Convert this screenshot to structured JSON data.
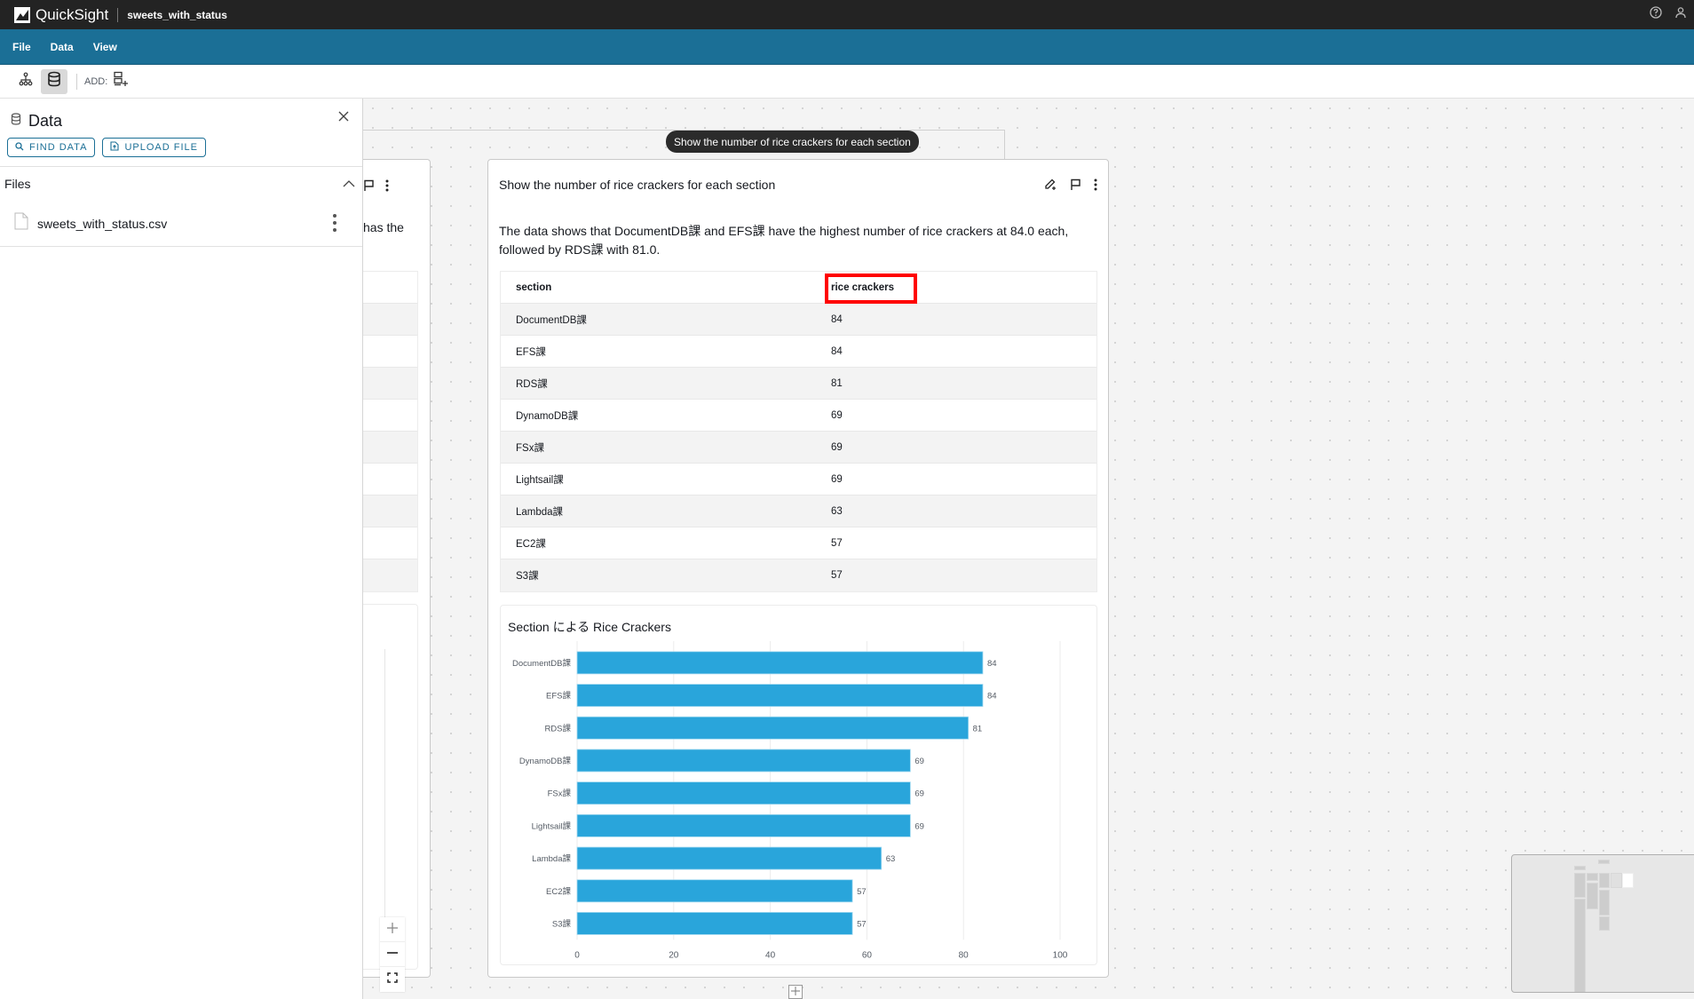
{
  "titlebar": {
    "app_name": "QuickSight",
    "file_title": "sweets_with_status",
    "icons": [
      "help-icon",
      "user-icon"
    ]
  },
  "menu": {
    "items": [
      "File",
      "Data",
      "View"
    ]
  },
  "toolbar": {
    "add_label": "ADD:",
    "icons": [
      "hierarchy-icon",
      "database-icon",
      "add-visual-icon"
    ]
  },
  "data_panel": {
    "title": "Data",
    "find_data_label": "FIND DATA",
    "upload_file_label": "UPLOAD FILE",
    "files_header": "Files",
    "files": [
      {
        "name": "sweets_with_status.csv"
      }
    ]
  },
  "left_card": {
    "partial_text": "has the"
  },
  "tooltip": {
    "text": "Show the number of rice crackers for each section"
  },
  "main_card": {
    "title": "Show the number of rice crackers for each section",
    "summary": "The data shows that DocumentDB課 and EFS課 have the highest number of rice crackers at 84.0 each, followed by RDS課 with 81.0.",
    "table": {
      "columns": [
        "section",
        "rice crackers"
      ],
      "highlighted_column": "rice crackers",
      "rows": [
        [
          "DocumentDB課",
          "84"
        ],
        [
          "EFS課",
          "84"
        ],
        [
          "RDS課",
          "81"
        ],
        [
          "DynamoDB課",
          "69"
        ],
        [
          "FSx課",
          "69"
        ],
        [
          "Lightsail課",
          "69"
        ],
        [
          "Lambda課",
          "63"
        ],
        [
          "EC2課",
          "57"
        ],
        [
          "S3課",
          "57"
        ]
      ]
    }
  },
  "chart_data": {
    "type": "bar",
    "orientation": "horizontal",
    "title": "Section による Rice Crackers",
    "xlabel": "",
    "ylabel": "",
    "categories": [
      "DocumentDB課",
      "EFS課",
      "RDS課",
      "DynamoDB課",
      "FSx課",
      "Lightsail課",
      "Lambda課",
      "EC2課",
      "S3課"
    ],
    "values": [
      84,
      84,
      81,
      69,
      69,
      69,
      63,
      57,
      57
    ],
    "xlim": [
      0,
      100
    ],
    "xticks": [
      0,
      20,
      40,
      60,
      80,
      100
    ],
    "grid": true,
    "data_labels": true,
    "bar_color": "#29a5db"
  },
  "colors": {
    "titlebar": "#232323",
    "menubar": "#1b6f96",
    "highlight": "#ff0000",
    "bar": "#29a5db"
  }
}
